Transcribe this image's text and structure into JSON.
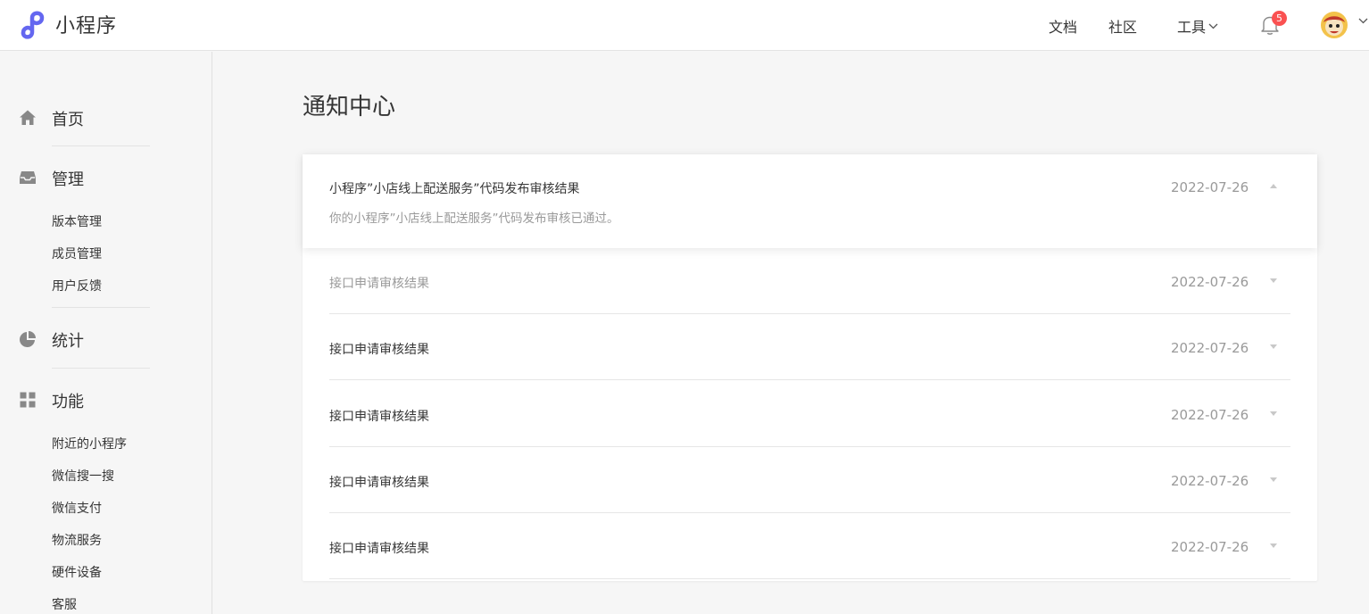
{
  "header": {
    "app_name": "小程序",
    "nav": {
      "docs": "文档",
      "community": "社区",
      "tools": "工具"
    },
    "notification_count": "5",
    "brand_color": "#6467f0"
  },
  "sidebar": {
    "home": "首页",
    "manage": {
      "label": "管理",
      "items": [
        "版本管理",
        "成员管理",
        "用户反馈"
      ]
    },
    "stats": "统计",
    "features": {
      "label": "功能",
      "items": [
        "附近的小程序",
        "微信搜一搜",
        "微信支付",
        "物流服务",
        "硬件设备",
        "客服"
      ]
    }
  },
  "main": {
    "title": "通知中心",
    "notices": [
      {
        "title": "小程序”小店线上配送服务”代码发布审核结果",
        "date": "2022-07-26",
        "content": "你的小程序”小店线上配送服务”代码发布审核已通过。",
        "expanded": true
      },
      {
        "title": "接口申请审核结果",
        "date": "2022-07-26",
        "read": true
      },
      {
        "title": "接口申请审核结果",
        "date": "2022-07-26"
      },
      {
        "title": "接口申请审核结果",
        "date": "2022-07-26"
      },
      {
        "title": "接口申请审核结果",
        "date": "2022-07-26"
      },
      {
        "title": "接口申请审核结果",
        "date": "2022-07-26"
      }
    ]
  }
}
